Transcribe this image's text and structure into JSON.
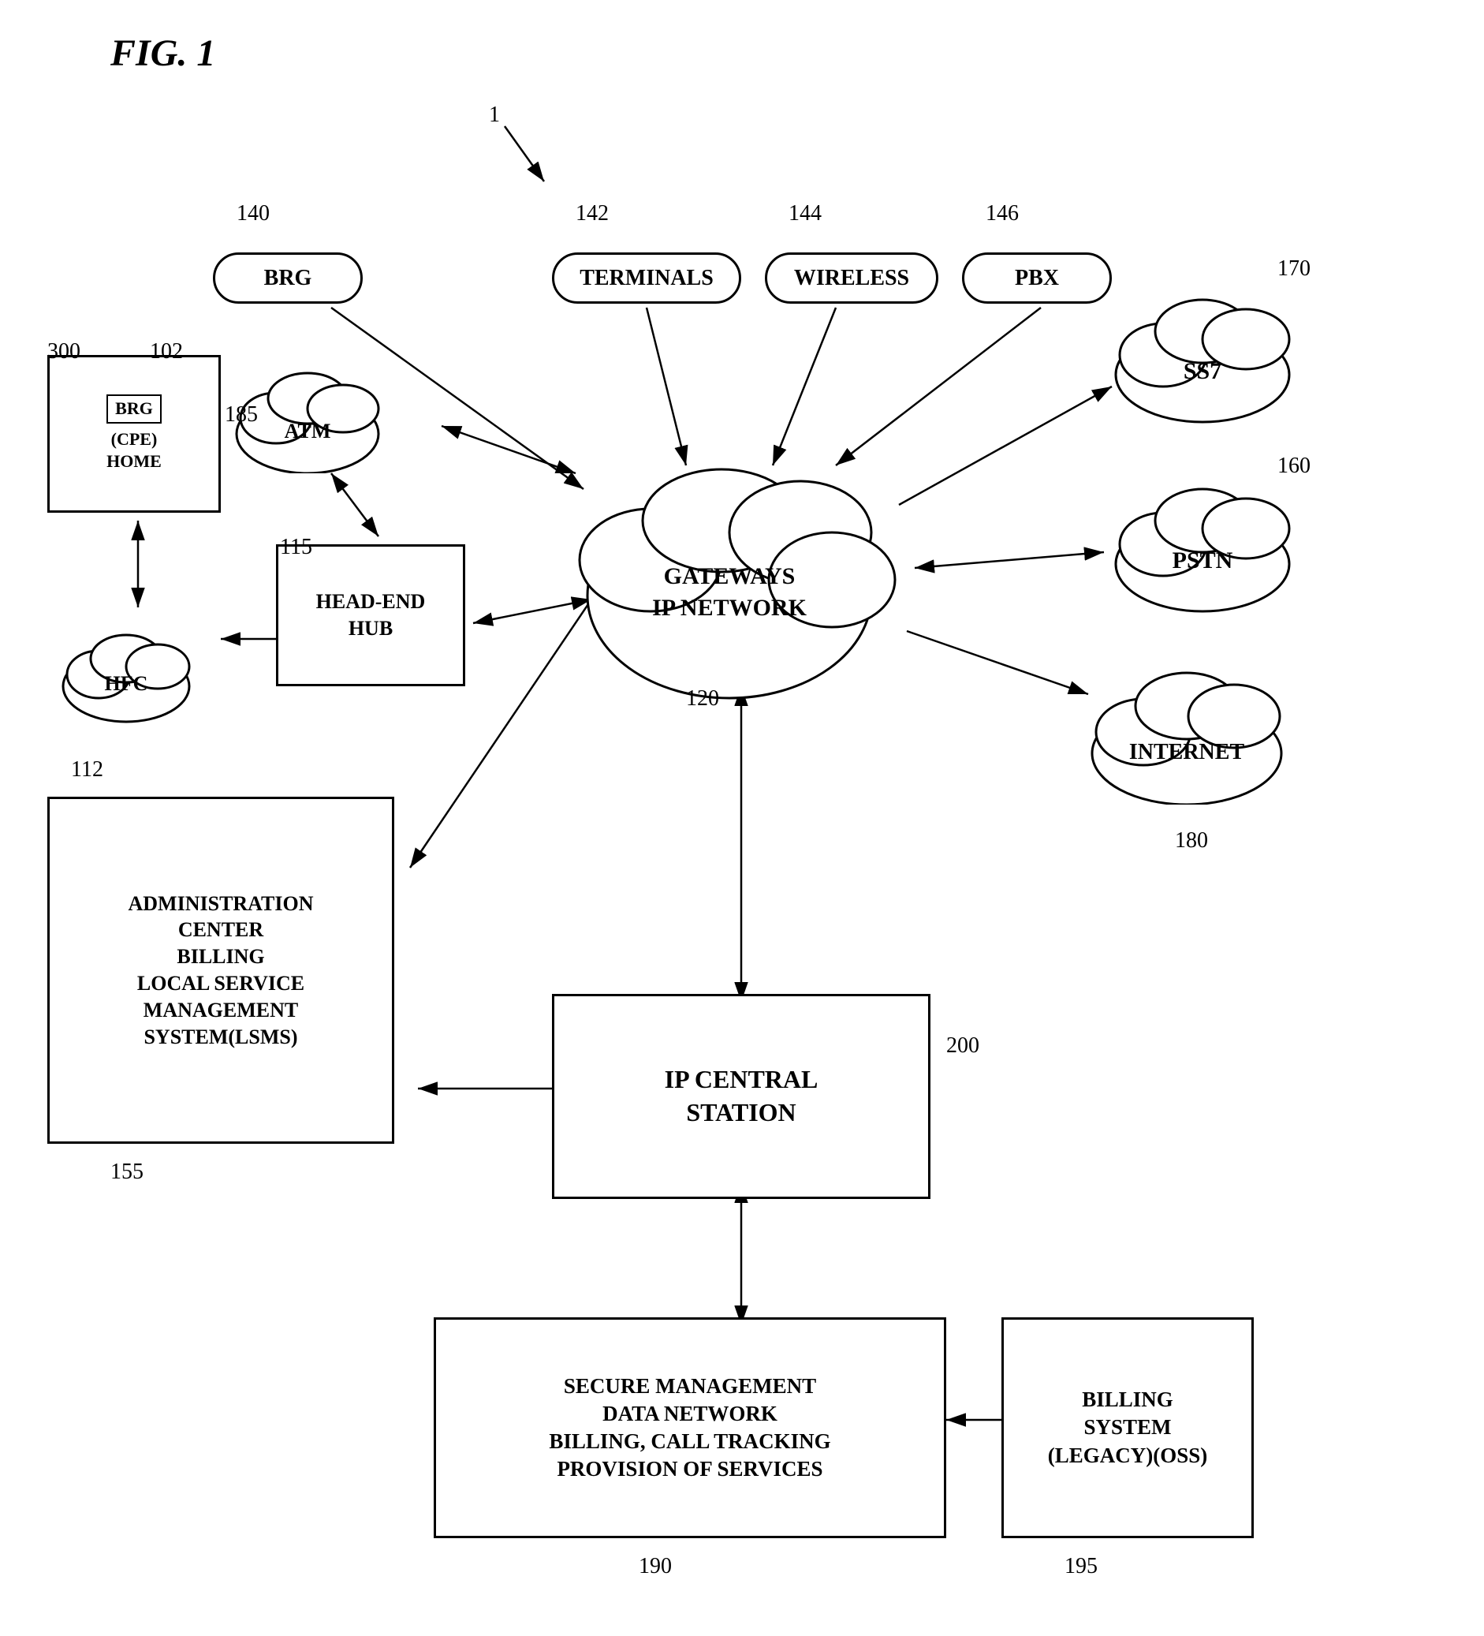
{
  "figure": {
    "title": "FIG. 1",
    "main_ref": "1"
  },
  "nodes": {
    "brg_home": {
      "label": "BRG\n(CPE)\nHOME",
      "ref": "102",
      "ref2": "300"
    },
    "hfc": {
      "label": "HFC",
      "ref": "112"
    },
    "head_end_hub": {
      "label": "HEAD-END\nHUB",
      "ref": "115"
    },
    "atm": {
      "label": "ATM",
      "ref": "185"
    },
    "brg": {
      "label": "BRG",
      "ref": "140"
    },
    "terminals": {
      "label": "TERMINALS",
      "ref": "142"
    },
    "wireless": {
      "label": "WIRELESS",
      "ref": "144"
    },
    "pbx": {
      "label": "PBX",
      "ref": "146"
    },
    "gateways_ip": {
      "label": "GATEWAYS\nIP NETWORK",
      "ref": "120"
    },
    "ss7": {
      "label": "SS7",
      "ref": "170"
    },
    "pstn": {
      "label": "PSTN",
      "ref": "160"
    },
    "internet": {
      "label": "INTERNET",
      "ref": "180"
    },
    "admin_center": {
      "label": "ADMINISTRATION\nCENTER\nBILLING\nLOCAL SERVICE\nMANAGEMENT\nSYSTEM(LSMS)",
      "ref": "155"
    },
    "ip_central_station": {
      "label": "IP CENTRAL\nSTATION",
      "ref": "200"
    },
    "secure_mgmt": {
      "label": "SECURE MANAGEMENT\nDATA NETWORK\nBILLING, CALL TRACKING\nPROVISION OF SERVICES",
      "ref": "190"
    },
    "billing_system": {
      "label": "BILLING\nSYSTEM\n(LEGACY)(OSS)",
      "ref": "195"
    }
  }
}
